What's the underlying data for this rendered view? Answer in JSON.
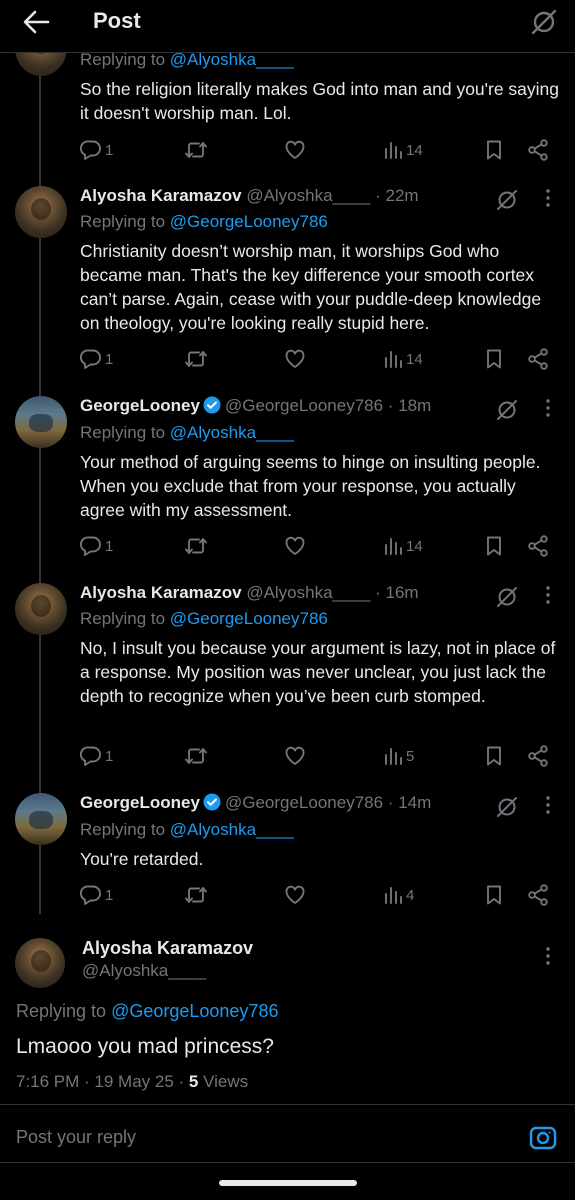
{
  "header": {
    "title": "Post"
  },
  "posts": [
    {
      "name": "",
      "handle": "",
      "time": "",
      "replying_prefix": "Replying to ",
      "replying_to": "@Alyoshka____",
      "text": "So the religion literally makes God into man and you're saying it doesn't worship man. Lol.",
      "replies": "1",
      "views": "14"
    },
    {
      "name": "Alyosha Karamazov",
      "handle": "@Alyoshka____",
      "time": "· 22m",
      "replying_prefix": "Replying to ",
      "replying_to": "@GeorgeLooney786",
      "text": "Christianity doesn’t worship man, it worships God who became man. That's the key difference your smooth cortex can’t parse. Again, cease with your puddle-deep knowledge on theology, you're looking really stupid here.",
      "replies": "1",
      "views": "14"
    },
    {
      "name": "GeorgeLooney",
      "handle": "@GeorgeLooney786",
      "time": "· 18m",
      "replying_prefix": "Replying to ",
      "replying_to": "@Alyoshka____",
      "text": "Your method of arguing seems to hinge on insulting people. When you exclude that from your response, you actually agree with my assessment.",
      "replies": "1",
      "views": "14"
    },
    {
      "name": "Alyosha Karamazov",
      "handle": "@Alyoshka____",
      "time": "· 16m",
      "replying_prefix": "Replying to ",
      "replying_to": "@GeorgeLooney786",
      "text": "No, I insult you because your argument is lazy, not in place of a response. My position was never unclear, you just lack the depth to recognize when you’ve been curb stomped.",
      "replies": "1",
      "views": "5"
    },
    {
      "name": "GeorgeLooney",
      "handle": "@GeorgeLooney786",
      "time": "· 14m",
      "replying_prefix": "Replying to ",
      "replying_to": "@Alyoshka____",
      "text": "You're retarded.",
      "replies": "1",
      "views": "4"
    }
  ],
  "main_post": {
    "name": "Alyosha Karamazov",
    "handle": "@Alyoshka____",
    "replying_prefix": "Replying to ",
    "replying_to": "@GeorgeLooney786",
    "text": "Lmaooo you mad princess?",
    "time": "7:16 PM · 19 May 25 · ",
    "views_count": "5",
    "views_label": " Views"
  },
  "reply_box": {
    "placeholder": "Post your reply"
  },
  "colors": {
    "accent": "#1d9bf0",
    "muted": "#71767b",
    "text": "#e7e9ea",
    "background": "#000000"
  }
}
